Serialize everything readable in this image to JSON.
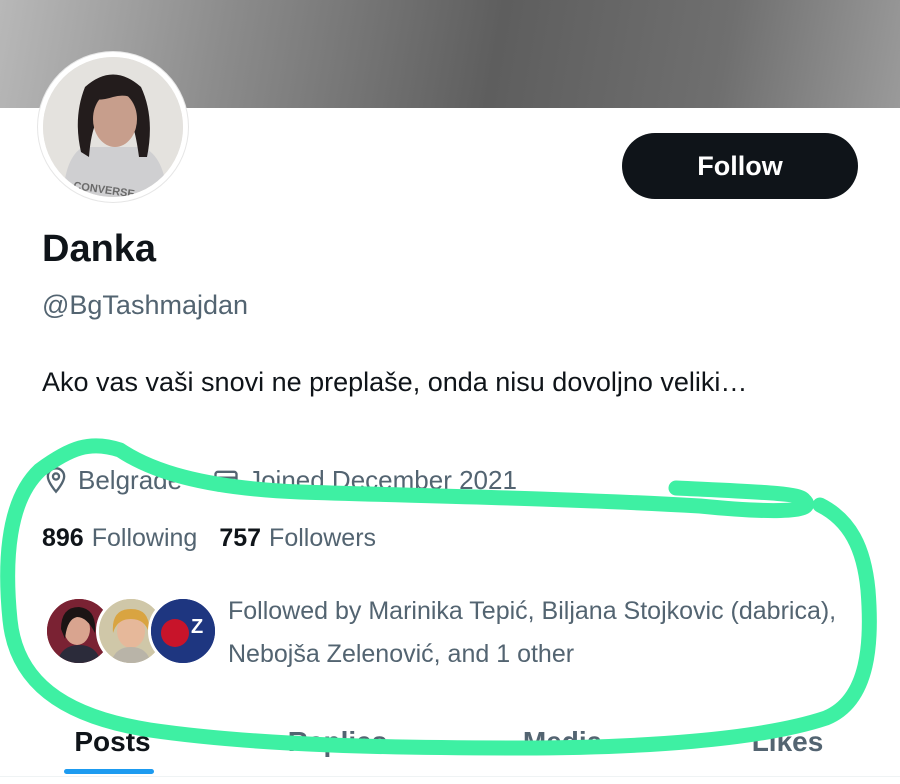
{
  "profile": {
    "name": "Danka",
    "handle": "@BgTashmajdan",
    "bio": "Ako vas vaši snovi ne preplaše, onda nisu dovoljno veliki…",
    "location": "Belgrade",
    "joined": "Joined December 2021",
    "following_count": "896",
    "following_label": "Following",
    "followers_count": "757",
    "followers_label": "Followers",
    "avatar_shirt_text": "CONVERSE"
  },
  "follow_button": {
    "label": "Follow"
  },
  "followed_by": {
    "text": "Followed by Marinika Tepić, Biljana Stojkovic (dabrica), Nebojša Zelenović, and 1 other"
  },
  "tabs": [
    {
      "label": "Posts"
    },
    {
      "label": "Replies"
    },
    {
      "label": "Media"
    },
    {
      "label": "Likes"
    }
  ],
  "colors": {
    "accent": "#1d9bf0",
    "button_bg": "#0f1419",
    "secondary_text": "#536471",
    "annotation_stroke": "#3ef0a3"
  },
  "icons": {
    "location": "location-pin-icon",
    "joined": "calendar-icon"
  }
}
